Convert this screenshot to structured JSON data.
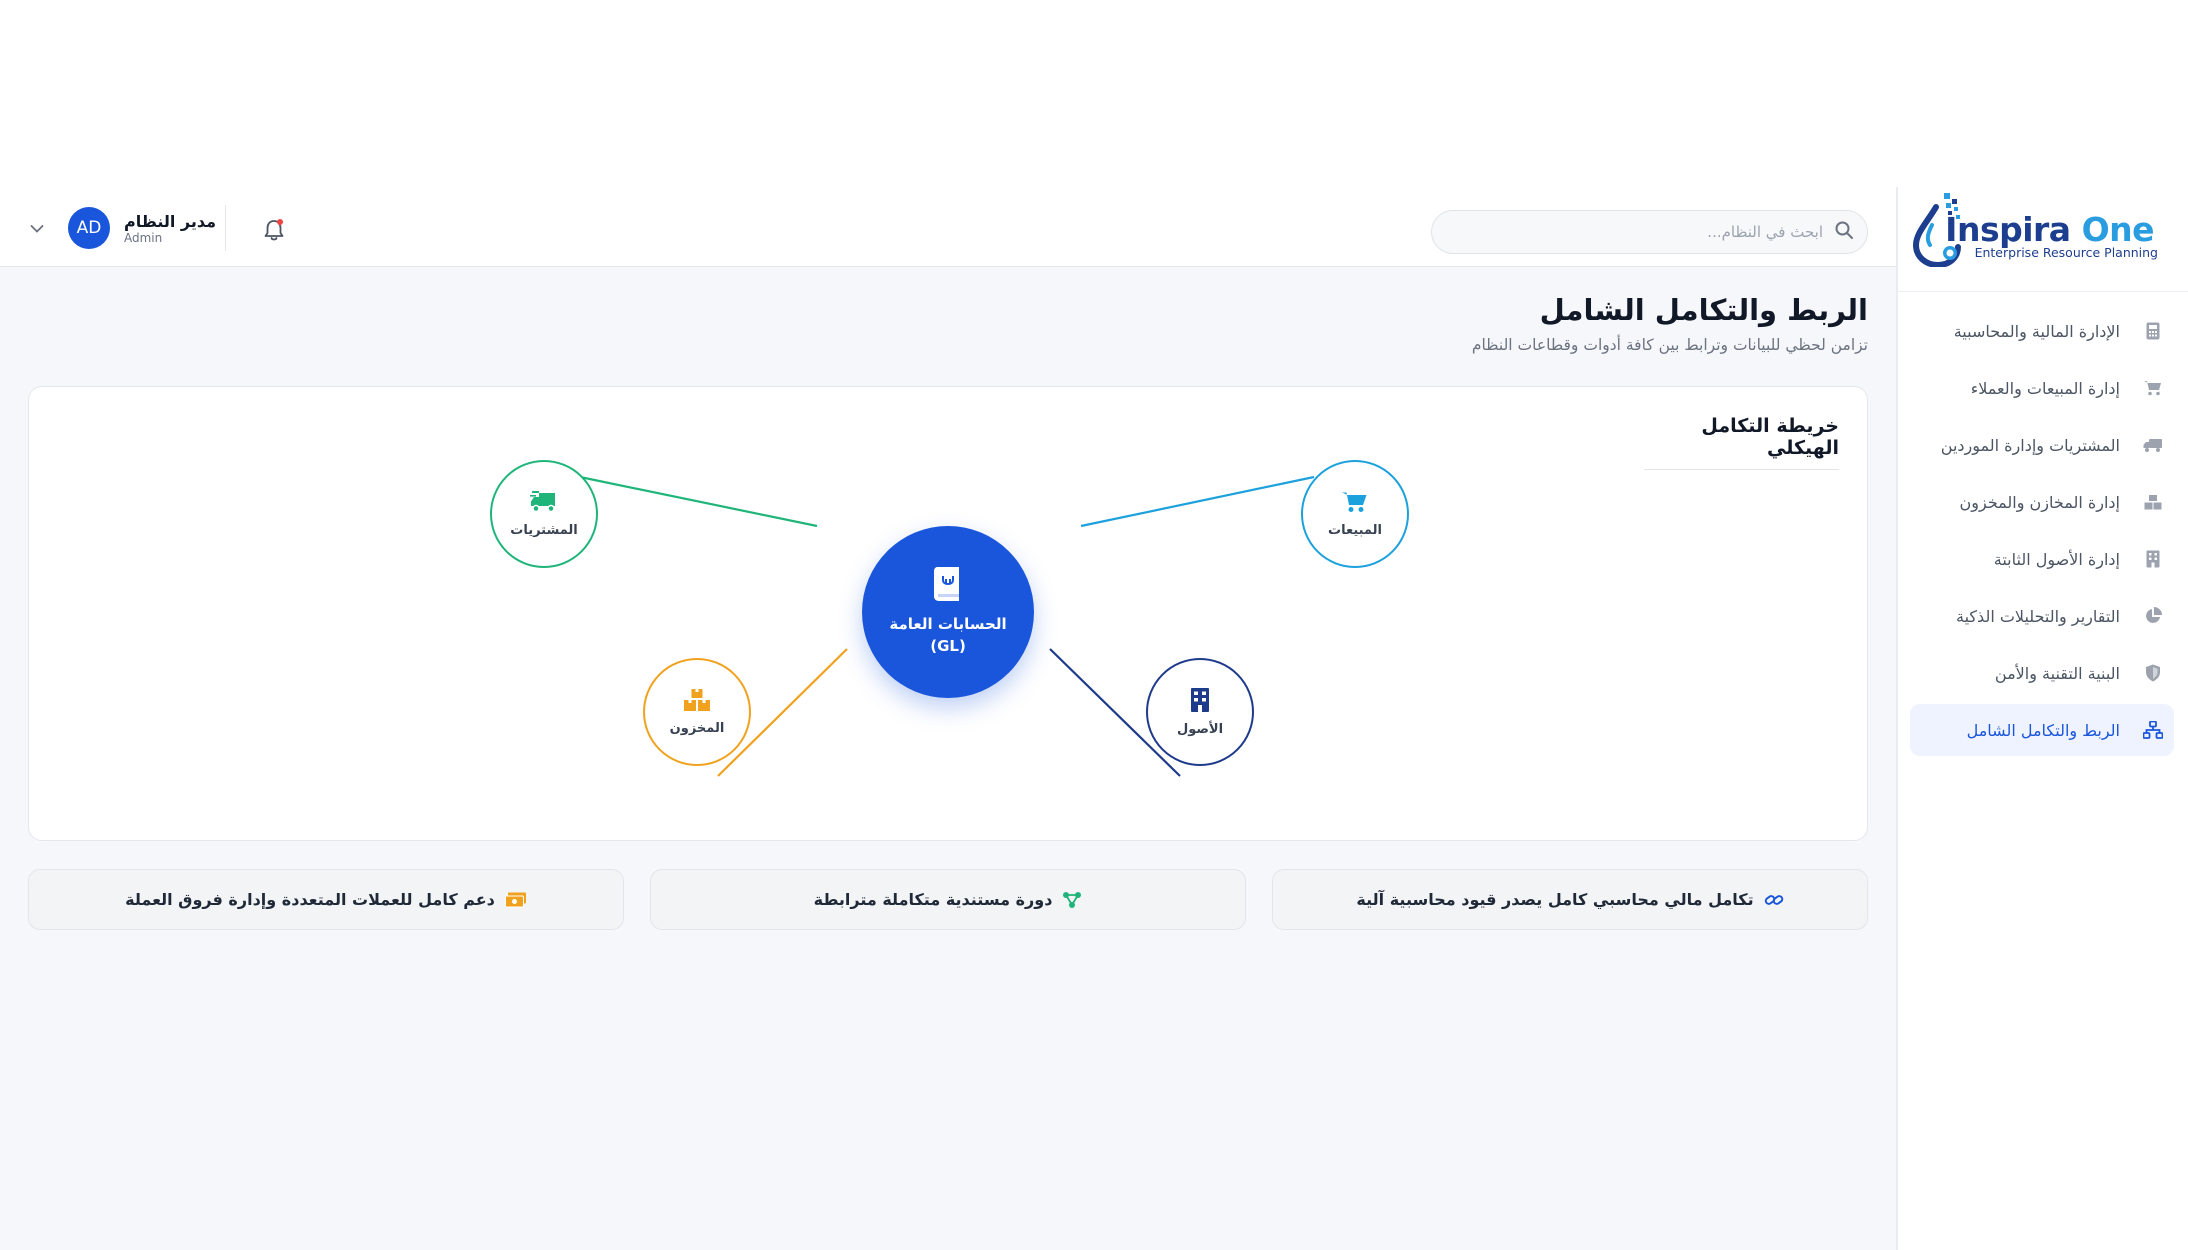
{
  "brand": {
    "name_main": "Inspira",
    "name_accent": "One",
    "tagline": "Enterprise Resource Planning"
  },
  "sidebar": {
    "items": [
      {
        "label": "الإدارة المالية والمحاسبية",
        "icon": "calculator-icon",
        "active": false
      },
      {
        "label": "إدارة المبيعات والعملاء",
        "icon": "cart-icon",
        "active": false
      },
      {
        "label": "المشتريات وإدارة الموردين",
        "icon": "truck-icon",
        "active": false
      },
      {
        "label": "إدارة المخازن والمخزون",
        "icon": "boxes-icon",
        "active": false
      },
      {
        "label": "إدارة الأصول الثابتة",
        "icon": "building-icon",
        "active": false
      },
      {
        "label": "التقارير والتحليلات الذكية",
        "icon": "pie-chart-icon",
        "active": false
      },
      {
        "label": "البنية التقنية والأمن",
        "icon": "shield-icon",
        "active": false
      },
      {
        "label": "الربط والتكامل الشامل",
        "icon": "network-icon",
        "active": true
      }
    ]
  },
  "header": {
    "search_placeholder": "ابحث في النظام...",
    "user_name": "مدير النظام",
    "user_role": "Admin",
    "user_initials": "AD"
  },
  "page": {
    "title": "الربط والتكامل الشامل",
    "subtitle": "تزامن لحظي للبيانات وترابط بين كافة أدوات وقطاعات النظام"
  },
  "map": {
    "title": "خريطة التكامل الهيكلي",
    "center": {
      "line1": "الحسابات العامة",
      "line2": "(GL)"
    },
    "nodes": {
      "sales": {
        "label": "المبيعات",
        "color": "#1da1dc"
      },
      "purchases": {
        "label": "المشتريات",
        "color": "#1fb57a"
      },
      "inventory": {
        "label": "المخزون",
        "color": "#f0a21f"
      },
      "assets": {
        "label": "الأصول",
        "color": "#1e3a8a"
      }
    }
  },
  "features": [
    {
      "label": "تكامل مالي محاسبي كامل يصدر قيود محاسبية آلية",
      "icon": "link-icon",
      "color": "#1a56db"
    },
    {
      "label": "دورة مستندية متكاملة مترابطة",
      "icon": "share-nodes-icon",
      "color": "#1fb57a"
    },
    {
      "label": "دعم كامل للعملات المتعددة وإدارة فروق العملة",
      "icon": "money-bill-icon",
      "color": "#f0a21f"
    }
  ],
  "colors": {
    "primary": "#1a56db",
    "notification_dot": "#ef4444"
  }
}
